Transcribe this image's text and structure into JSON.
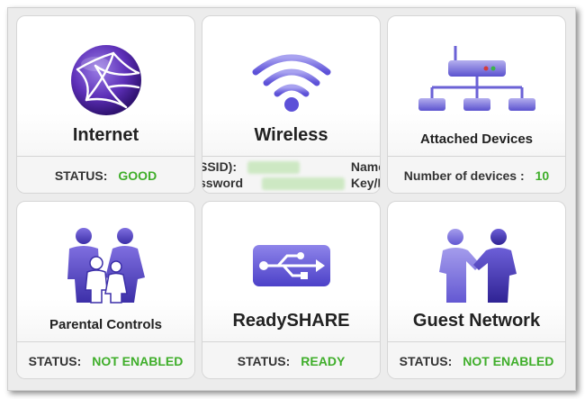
{
  "tiles": {
    "internet": {
      "title": "Internet",
      "status_label": "STATUS:",
      "status_value": "GOOD",
      "icon": "globe-icon"
    },
    "wireless": {
      "title": "Wireless",
      "icon": "wifi-icon",
      "row1_left": "SSID):",
      "row1_right": "Name",
      "row2_left": "ssword",
      "row2_right": "Key/F"
    },
    "attached_devices": {
      "title": "Attached Devices",
      "status_label": "Number of devices :",
      "status_value": "10",
      "icon": "router-network-icon"
    },
    "parental_controls": {
      "title": "Parental Controls",
      "status_label": "STATUS:",
      "status_value": "NOT ENABLED",
      "icon": "family-icon"
    },
    "readyshare": {
      "title": "ReadySHARE",
      "status_label": "STATUS:",
      "status_value": "READY",
      "icon": "usb-icon"
    },
    "guest_network": {
      "title": "Guest Network",
      "status_label": "STATUS:",
      "status_value": "NOT ENABLED",
      "icon": "handshake-icon"
    }
  },
  "colors": {
    "accent": "#6a5acd",
    "status_good": "#3fae2a",
    "text": "#222222"
  }
}
